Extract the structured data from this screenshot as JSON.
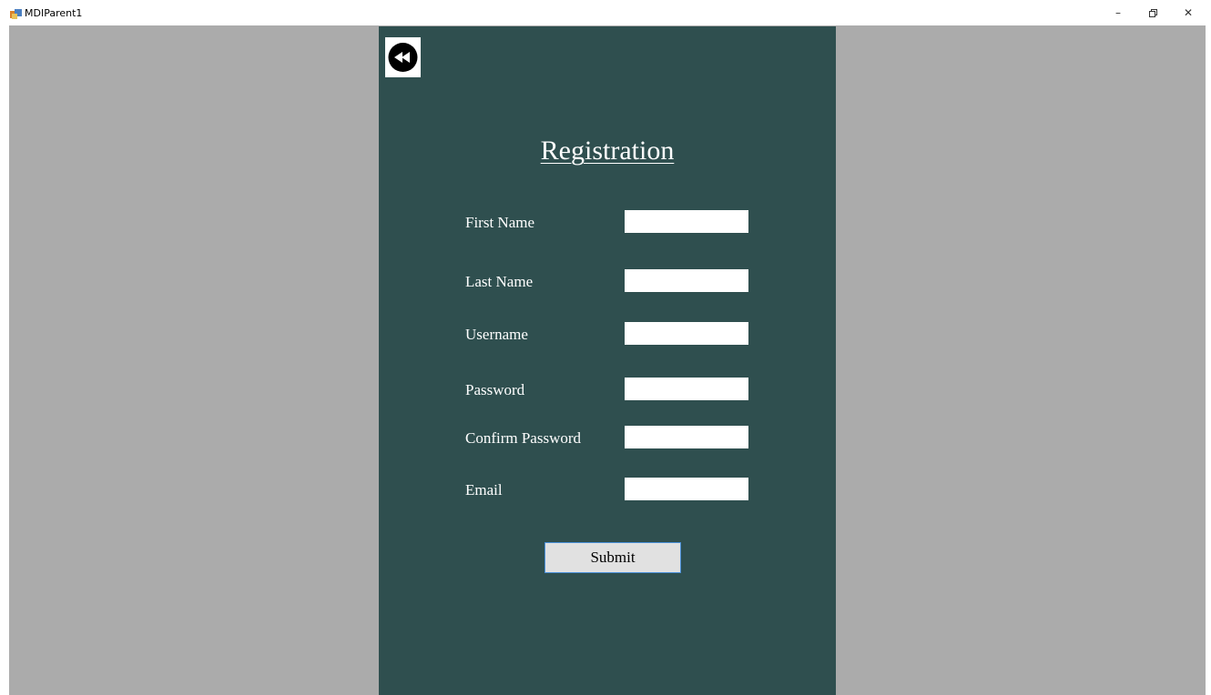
{
  "window": {
    "title": "MDIParent1",
    "controls": {
      "minimize": "–",
      "restore": "▫",
      "close": "✕"
    }
  },
  "form": {
    "title": "Registration",
    "back_icon": "rewind-icon",
    "fields": [
      {
        "label": "First Name",
        "value": "",
        "placeholder": ""
      },
      {
        "label": "Last Name",
        "value": "",
        "placeholder": ""
      },
      {
        "label": "Username",
        "value": "",
        "placeholder": ""
      },
      {
        "label": "Password",
        "value": "",
        "placeholder": ""
      },
      {
        "label": "Confirm Password",
        "value": "",
        "placeholder": ""
      },
      {
        "label": "Email",
        "value": "",
        "placeholder": ""
      }
    ],
    "submit_label": "Submit"
  },
  "colors": {
    "form_background": "#2f4f4f",
    "mdi_background": "#ababab",
    "button_border": "#4a90d9"
  }
}
